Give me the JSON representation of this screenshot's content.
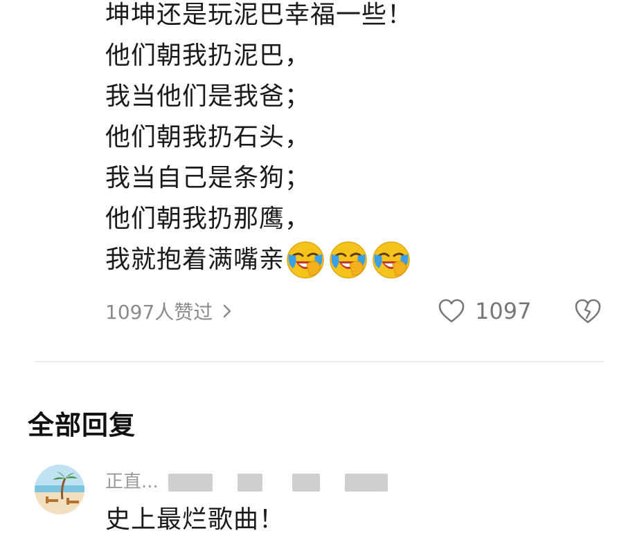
{
  "poem": {
    "lines": [
      "坤坤还是玩泥巴幸福一些！",
      "他们朝我扔泥巴，",
      "我当他们是我爸；",
      "他们朝我扔石头，",
      "我当自己是条狗；",
      "他们朝我扔那鹰，",
      "我就抱着满嘴亲"
    ],
    "trailing_emojis": [
      "laughing-crying-emoji",
      "laughing-crying-emoji",
      "laughing-crying-emoji"
    ]
  },
  "reactions": {
    "likes_summary": "1097人赞过",
    "like_count": "1097",
    "icons": {
      "chevron": "chevron-right-icon",
      "like": "heart-outline-icon",
      "dislike": "broken-heart-icon"
    }
  },
  "replies_section": {
    "title": "全部回复",
    "items": [
      {
        "username": "正直...",
        "username_partially_redacted": true,
        "text": "史上最烂歌曲！",
        "avatar": "beach-scene-avatar"
      }
    ]
  },
  "colors": {
    "text_primary": "#1a1a1a",
    "text_secondary": "#8a8a8a",
    "divider": "#ececec",
    "emoji_face": "#f6c21c"
  }
}
